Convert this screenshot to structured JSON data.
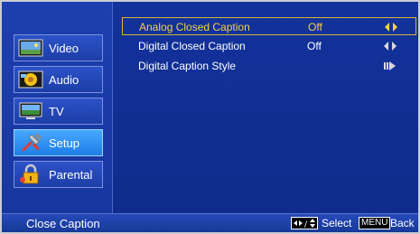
{
  "sidebar": {
    "items": [
      {
        "label": "Video",
        "icon": "video-icon"
      },
      {
        "label": "Audio",
        "icon": "audio-icon"
      },
      {
        "label": "TV",
        "icon": "tv-icon"
      },
      {
        "label": "Setup",
        "icon": "setup-icon",
        "active": true
      },
      {
        "label": "Parental",
        "icon": "parental-lock-icon"
      }
    ]
  },
  "options": [
    {
      "label": "Analog Closed Caption",
      "value": "Off",
      "selected": true
    },
    {
      "label": "Digital Closed Caption",
      "value": "Off",
      "selected": false
    },
    {
      "label": "Digital Caption Style",
      "value": "",
      "selected": false
    }
  ],
  "footer": {
    "title": "Close Caption",
    "select_label": "Select",
    "menu_key": "MENU",
    "back_label": "Back"
  },
  "colors": {
    "background": "#0d2a8c",
    "selection_border": "#d4b83c",
    "selection_text": "#f3d14a",
    "active_item": "#2d8cf0"
  }
}
